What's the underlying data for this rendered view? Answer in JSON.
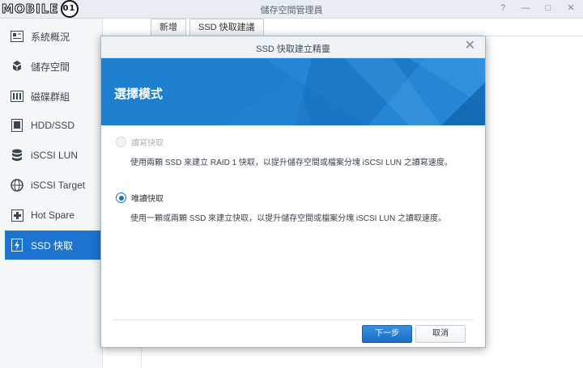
{
  "window": {
    "title": "儲存空間管理員",
    "controls": [
      "pin-icon",
      "minimize-icon",
      "maximize-icon",
      "close-icon"
    ]
  },
  "watermark": {
    "text": "MOBILE",
    "badge": "01"
  },
  "sidebar": {
    "items": [
      {
        "label": "系統概況",
        "icon": "overview-icon"
      },
      {
        "label": "儲存空間",
        "icon": "storage-icon"
      },
      {
        "label": "磁碟群組",
        "icon": "disk-group-icon"
      },
      {
        "label": "HDD/SSD",
        "icon": "hdd-ssd-icon"
      },
      {
        "label": "iSCSI LUN",
        "icon": "iscsi-lun-icon"
      },
      {
        "label": "iSCSI Target",
        "icon": "iscsi-target-icon"
      },
      {
        "label": "Hot Spare",
        "icon": "hot-spare-icon"
      },
      {
        "label": "SSD 快取",
        "icon": "ssd-cache-icon",
        "active": true
      }
    ]
  },
  "toolbar": {
    "new_label": "新增",
    "advisor_label": "SSD 快取建議"
  },
  "dialog": {
    "title": "SSD 快取建立精靈",
    "heading": "選擇模式",
    "options": [
      {
        "label": "讀寫快取",
        "description": "使用兩顆 SSD 來建立 RAID 1 快取，以提升儲存空間或檔案分塊 iSCSI LUN 之讀寫速度。",
        "selected": false,
        "disabled": true
      },
      {
        "label": "唯讀快取",
        "description": "使用一顆或兩顆 SSD 來建立快取，以提升儲存空間或檔案分塊 iSCSI LUN 之讀取速度。",
        "selected": true,
        "disabled": false
      }
    ],
    "next_label": "下一步",
    "cancel_label": "取消"
  },
  "colors": {
    "accent": "#1e7fcf",
    "active_sidebar": "#1c74cf",
    "primary_button": "#1a6fc4"
  }
}
